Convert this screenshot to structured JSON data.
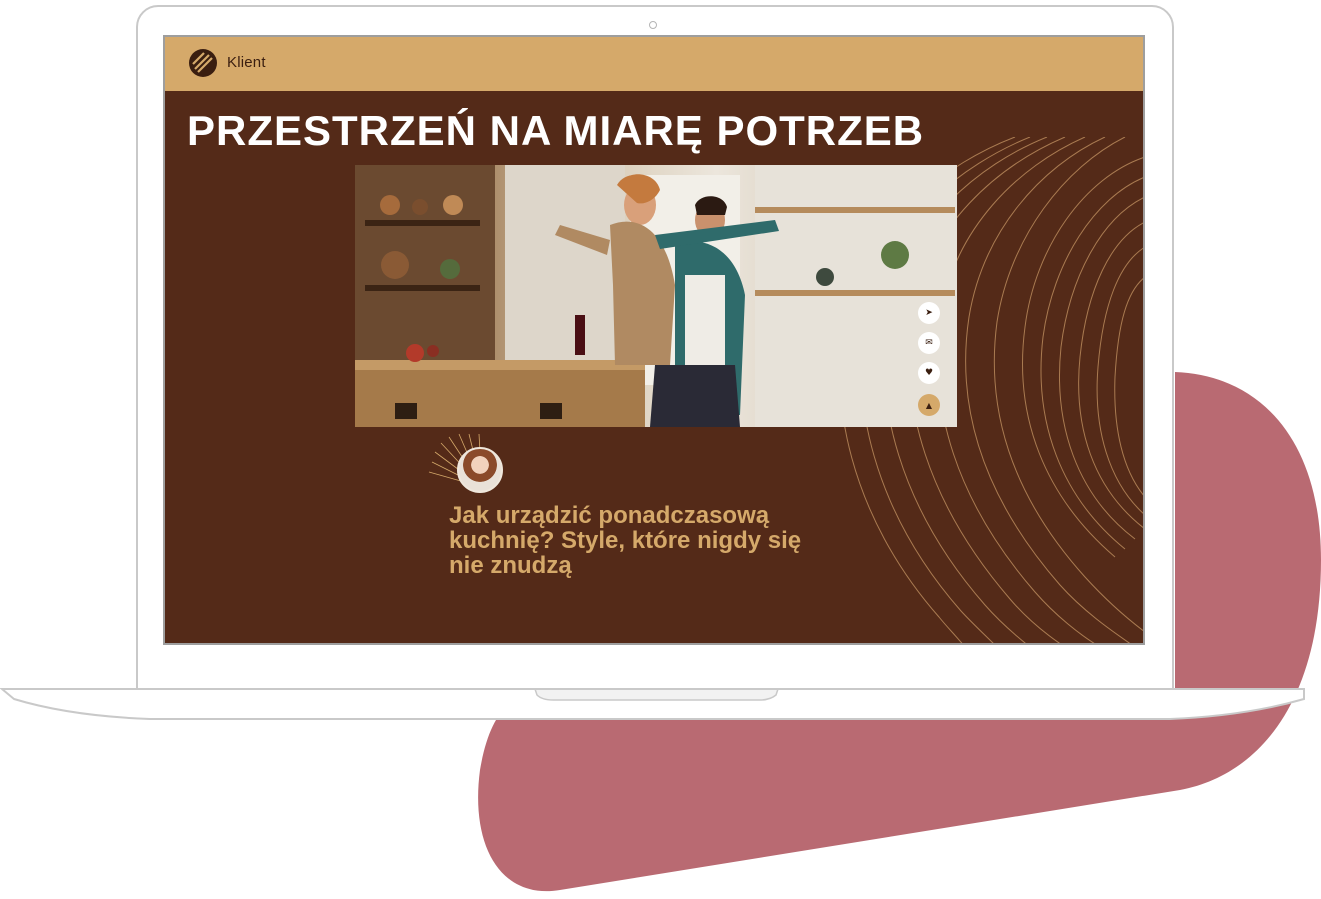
{
  "site": {
    "brand": "Klient",
    "hero_title": "PRZESTRZEŃ NA MIARĘ POTRZEB"
  },
  "article": {
    "author_meta_line1": "",
    "author_meta_line2": "",
    "title": "Jak urządzić ponadczasową kuchnię? Style, które nigdy się nie znudzą",
    "excerpt": ""
  },
  "social": {
    "icons": [
      "share-icon",
      "email-icon",
      "twitter-icon",
      "scroll-up-icon"
    ]
  },
  "colors": {
    "page_background": "#542a18",
    "header": "#d5a96a",
    "accent": "#d5a96a",
    "blob": "#b96a72",
    "hero_text": "#ffffff"
  }
}
